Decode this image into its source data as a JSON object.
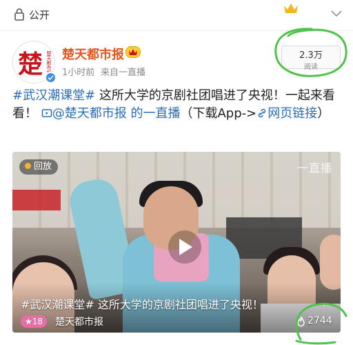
{
  "topbar": {
    "privacy_label": "公开",
    "lock_icon": "lock-icon",
    "crown_icon": "crown-icon",
    "collapse_icon": "chevron-down-icon"
  },
  "post": {
    "avatar_char": "楚",
    "avatar_side_text": "楚天都市报",
    "username": "楚天都市报",
    "time": "1小时前",
    "source": "来自一直播",
    "views_count": "2.3万",
    "views_label": "阅读",
    "text": {
      "hashtag": "#武汉潮课堂#",
      "body": " 这所大学的京剧社团唱进了央视！一起来看看！",
      "video_link": "@楚天都市报 的一直播",
      "suffix": "（下载App->",
      "web_link": "网页链接",
      "close": "）"
    }
  },
  "video": {
    "replay_label": "回放",
    "watermark": "一直播",
    "title": "#武汉潮课堂# 这所大学的京剧社团唱进了央视！",
    "more": "…",
    "like_count": "18",
    "author": "楚天都市报",
    "play_count": "2744"
  },
  "colors": {
    "username": "#e8541c",
    "link": "#2a6cb5",
    "verified": "#3d8ee8",
    "annotation": "#4fc24a"
  }
}
